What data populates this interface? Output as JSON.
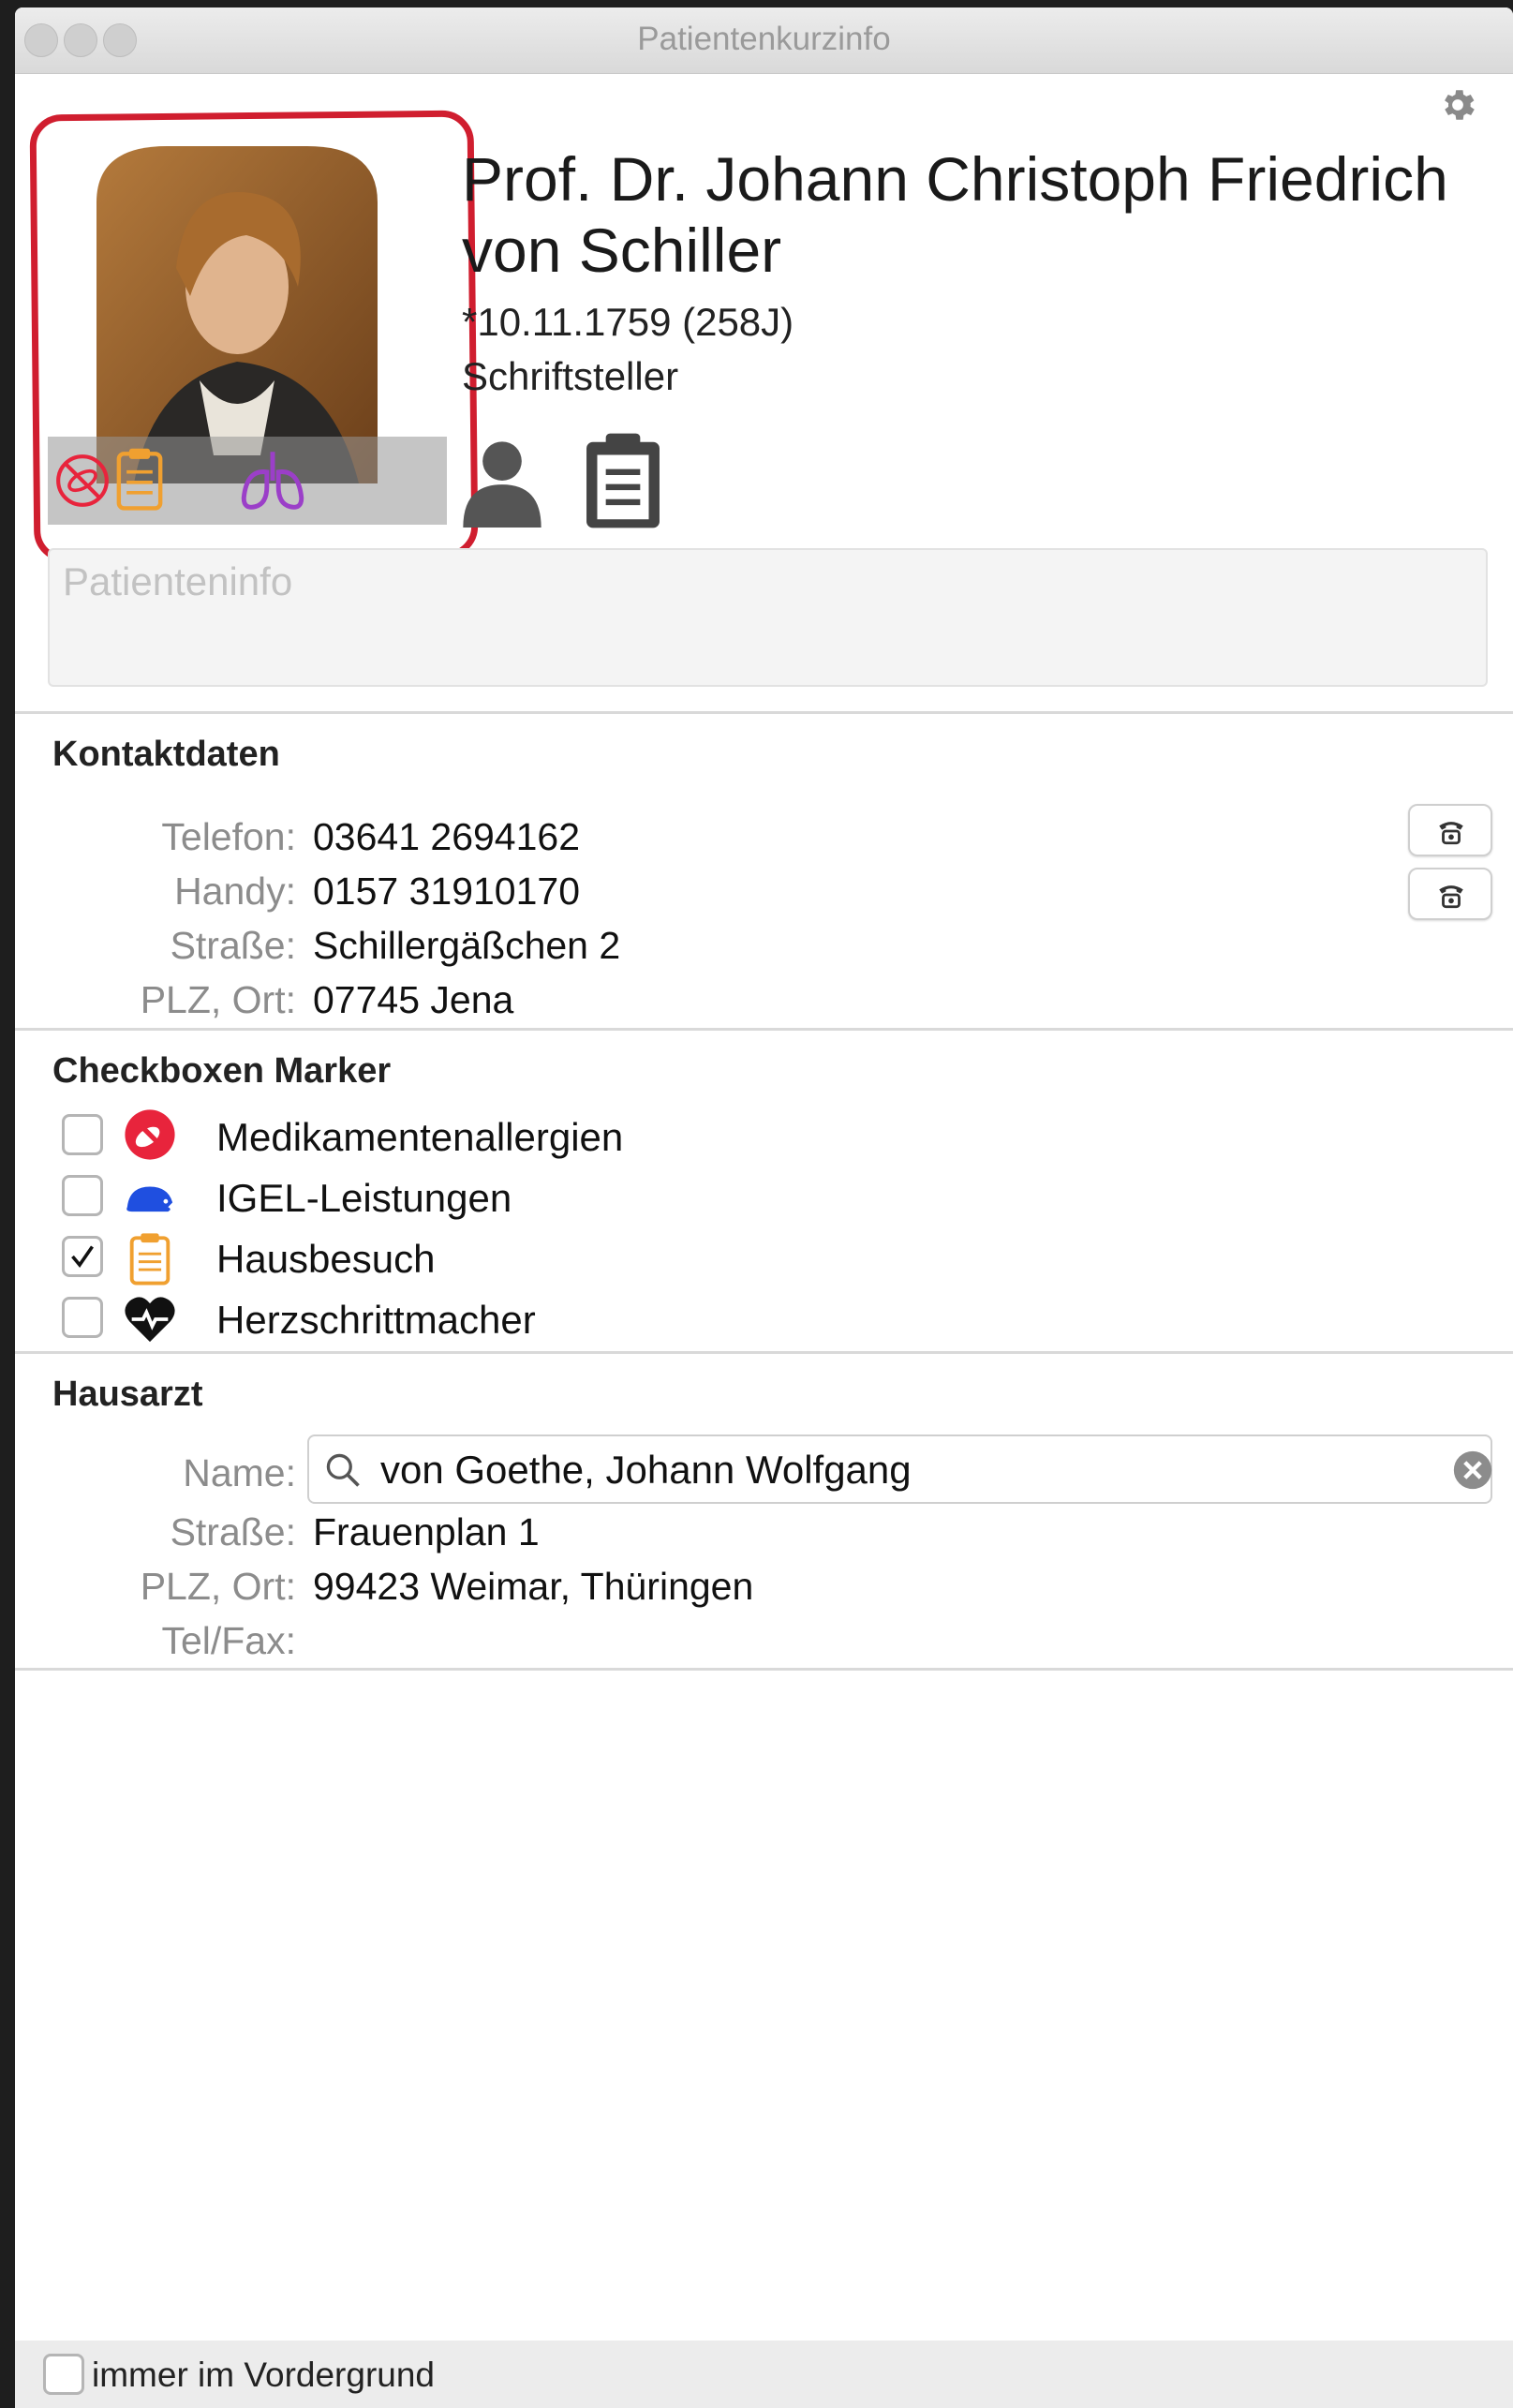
{
  "window": {
    "title": "Patientenkurzinfo"
  },
  "patient": {
    "name": "Prof. Dr. Johann Christoph Friedrich von Schiller",
    "birth": "*10.11.1759 (258J)",
    "occupation": "Schriftsteller",
    "info_placeholder": "Patienteninfo",
    "photo_marker_icons": [
      "allergy-icon",
      "clipboard-icon",
      "lungs-icon"
    ]
  },
  "contact": {
    "title": "Kontaktdaten",
    "rows": [
      {
        "label": "Telefon:",
        "value": "03641 2694162",
        "has_call_button": true
      },
      {
        "label": "Handy:",
        "value": "0157 31910170",
        "has_call_button": true
      },
      {
        "label": "Straße:",
        "value": "Schillergäßchen 2"
      },
      {
        "label": "PLZ, Ort:",
        "value": "07745 Jena"
      }
    ]
  },
  "markers": {
    "title": "Checkboxen Marker",
    "items": [
      {
        "label": "Medikamentenallergien",
        "checked": false,
        "icon": "allergy-icon",
        "color": "#e8243c"
      },
      {
        "label": "IGEL-Leistungen",
        "checked": false,
        "icon": "hedgehog-icon",
        "color": "#1f4fe0"
      },
      {
        "label": "Hausbesuch",
        "checked": true,
        "icon": "clipboard-icon",
        "color": "#f0a030"
      },
      {
        "label": "Herzschrittmacher",
        "checked": false,
        "icon": "heart-pulse-icon",
        "color": "#111111"
      }
    ]
  },
  "gp": {
    "title": "Hausarzt",
    "name_label": "Name:",
    "name_value": "von Goethe, Johann Wolfgang",
    "street_label": "Straße:",
    "street_value": "Frauenplan 1",
    "city_label": "PLZ, Ort:",
    "city_value": "99423 Weimar, Thüringen",
    "telfax_label": "Tel/Fax:",
    "telfax_value": ""
  },
  "footer": {
    "always_on_top_label": "immer im Vordergrund",
    "checked": false
  }
}
